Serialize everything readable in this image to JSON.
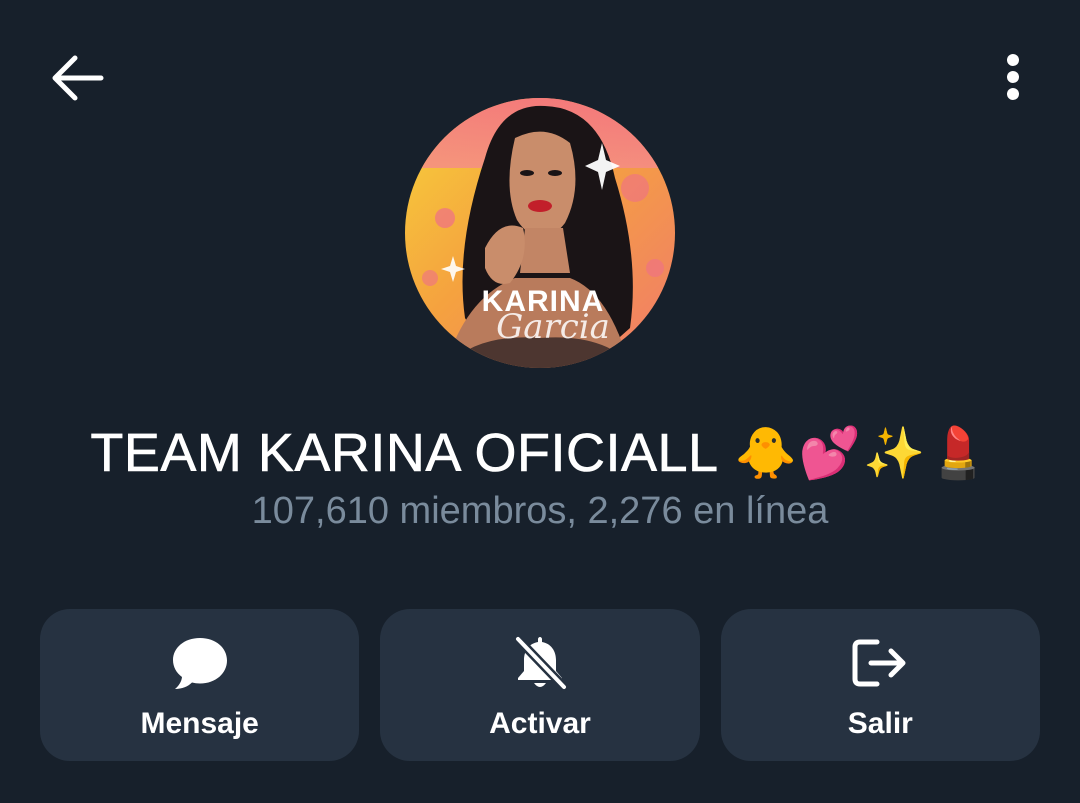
{
  "header": {
    "back_icon": "arrow-left-icon",
    "menu_icon": "more-vertical-icon"
  },
  "channel": {
    "avatar_text": "KARINA",
    "avatar_script": "Garcia",
    "title": "TEAM KARINA OFICIALL",
    "emojis": [
      "🐥",
      "💕",
      "✨",
      "💄"
    ],
    "subtitle": "107,610 miembros, 2,276 en línea"
  },
  "actions": [
    {
      "label": "Mensaje",
      "icon": "chat-bubble-icon"
    },
    {
      "label": "Activar",
      "icon": "bell-off-icon"
    },
    {
      "label": "Salir",
      "icon": "logout-icon"
    }
  ],
  "colors": {
    "background": "#17202b",
    "card": "#263241",
    "subtitle": "#7a8b9c",
    "text": "#ffffff"
  }
}
